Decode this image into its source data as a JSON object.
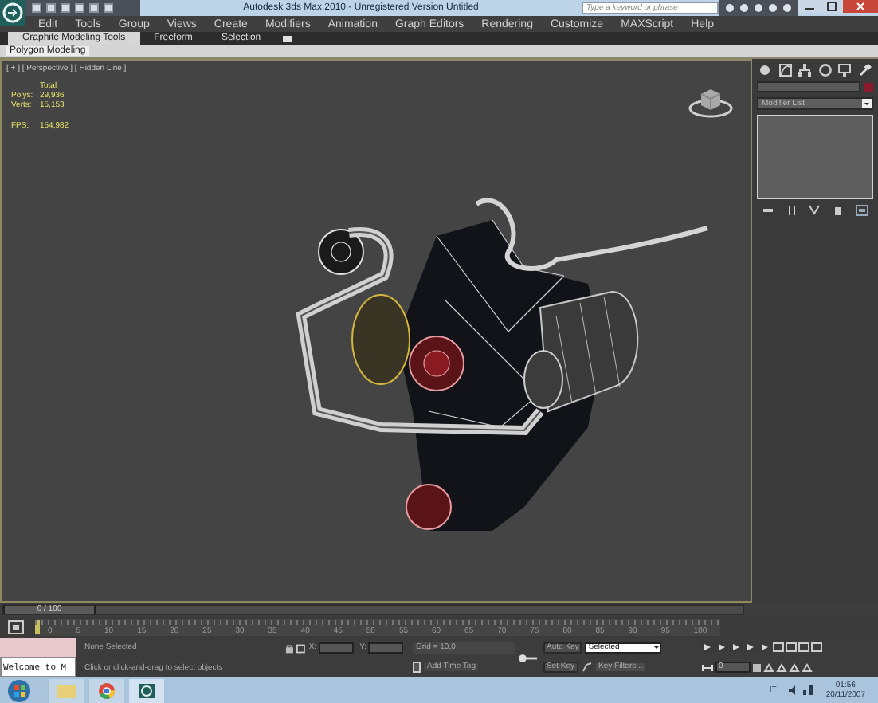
{
  "title_bar": {
    "title": "Autodesk 3ds Max 2010  -  Unregistered Version    Untitled",
    "search": {
      "placeholder": "Type a keyword or phrase"
    }
  },
  "menu": [
    "Edit",
    "Tools",
    "Group",
    "Views",
    "Create",
    "Modifiers",
    "Animation",
    "Graph Editors",
    "Rendering",
    "Customize",
    "MAXScript",
    "Help"
  ],
  "ribbon": {
    "tabs": [
      {
        "label": "Graphite Modeling Tools",
        "selected": true
      },
      {
        "label": "Freeform",
        "selected": false
      },
      {
        "label": "Selection",
        "selected": false
      }
    ],
    "panel": "Polygon Modeling"
  },
  "viewport": {
    "label": "[ + ] [ Perspective ] [ Hidden Line ]",
    "stats_header": "Total",
    "stats": [
      {
        "label": "Polys:",
        "value": "29,936"
      },
      {
        "label": "Verts:",
        "value": "15,153"
      }
    ],
    "fps": {
      "label": "FPS:",
      "value": "154,982"
    }
  },
  "command_panel": {
    "modifier_list": {
      "placeholder": "Modifier List"
    }
  },
  "time_slider": {
    "label": "0 / 100",
    "level": 0
  },
  "track_bar": {
    "ticks": [
      "0",
      "5",
      "10",
      "15",
      "20",
      "25",
      "30",
      "35",
      "40",
      "45",
      "50",
      "55",
      "60",
      "65",
      "70",
      "75",
      "80",
      "85",
      "90",
      "95",
      "100"
    ]
  },
  "status": {
    "listener": "Welcome to M",
    "selection": "None Selected",
    "prompt": "Click or click-and-drag to select objects",
    "x_label": "X:",
    "y_label": "Y:",
    "grid": "Grid = 10,0",
    "time_tag": "Add Time Tag",
    "auto_key": "Auto Key",
    "key_mode": "Selected",
    "set_key": "Set Key",
    "key_filters": "Key Filters...",
    "frame": "0"
  },
  "taskbar": {
    "language": "IT",
    "time": "01:56",
    "date": "20/11/2007"
  }
}
